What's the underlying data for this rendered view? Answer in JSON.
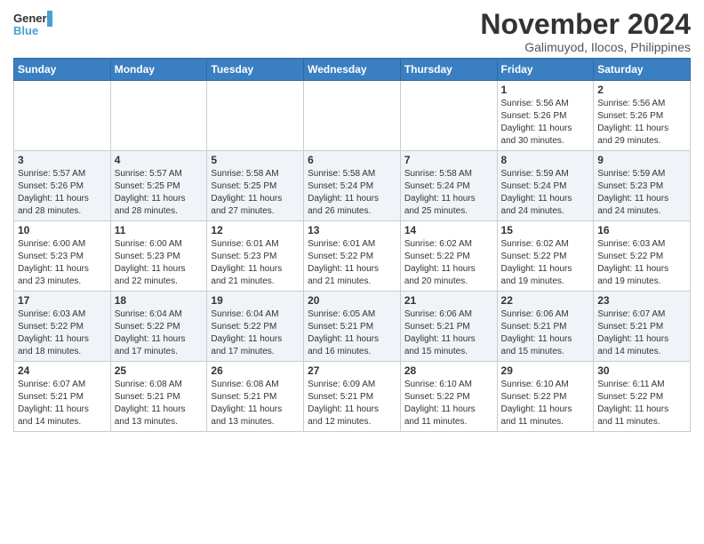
{
  "header": {
    "logo_line1": "General",
    "logo_line2": "Blue",
    "month_title": "November 2024",
    "location": "Galimuyod, Ilocos, Philippines"
  },
  "weekdays": [
    "Sunday",
    "Monday",
    "Tuesday",
    "Wednesday",
    "Thursday",
    "Friday",
    "Saturday"
  ],
  "weeks": [
    [
      {
        "day": "",
        "info": ""
      },
      {
        "day": "",
        "info": ""
      },
      {
        "day": "",
        "info": ""
      },
      {
        "day": "",
        "info": ""
      },
      {
        "day": "",
        "info": ""
      },
      {
        "day": "1",
        "info": "Sunrise: 5:56 AM\nSunset: 5:26 PM\nDaylight: 11 hours\nand 30 minutes."
      },
      {
        "day": "2",
        "info": "Sunrise: 5:56 AM\nSunset: 5:26 PM\nDaylight: 11 hours\nand 29 minutes."
      }
    ],
    [
      {
        "day": "3",
        "info": "Sunrise: 5:57 AM\nSunset: 5:26 PM\nDaylight: 11 hours\nand 28 minutes."
      },
      {
        "day": "4",
        "info": "Sunrise: 5:57 AM\nSunset: 5:25 PM\nDaylight: 11 hours\nand 28 minutes."
      },
      {
        "day": "5",
        "info": "Sunrise: 5:58 AM\nSunset: 5:25 PM\nDaylight: 11 hours\nand 27 minutes."
      },
      {
        "day": "6",
        "info": "Sunrise: 5:58 AM\nSunset: 5:24 PM\nDaylight: 11 hours\nand 26 minutes."
      },
      {
        "day": "7",
        "info": "Sunrise: 5:58 AM\nSunset: 5:24 PM\nDaylight: 11 hours\nand 25 minutes."
      },
      {
        "day": "8",
        "info": "Sunrise: 5:59 AM\nSunset: 5:24 PM\nDaylight: 11 hours\nand 24 minutes."
      },
      {
        "day": "9",
        "info": "Sunrise: 5:59 AM\nSunset: 5:23 PM\nDaylight: 11 hours\nand 24 minutes."
      }
    ],
    [
      {
        "day": "10",
        "info": "Sunrise: 6:00 AM\nSunset: 5:23 PM\nDaylight: 11 hours\nand 23 minutes."
      },
      {
        "day": "11",
        "info": "Sunrise: 6:00 AM\nSunset: 5:23 PM\nDaylight: 11 hours\nand 22 minutes."
      },
      {
        "day": "12",
        "info": "Sunrise: 6:01 AM\nSunset: 5:23 PM\nDaylight: 11 hours\nand 21 minutes."
      },
      {
        "day": "13",
        "info": "Sunrise: 6:01 AM\nSunset: 5:22 PM\nDaylight: 11 hours\nand 21 minutes."
      },
      {
        "day": "14",
        "info": "Sunrise: 6:02 AM\nSunset: 5:22 PM\nDaylight: 11 hours\nand 20 minutes."
      },
      {
        "day": "15",
        "info": "Sunrise: 6:02 AM\nSunset: 5:22 PM\nDaylight: 11 hours\nand 19 minutes."
      },
      {
        "day": "16",
        "info": "Sunrise: 6:03 AM\nSunset: 5:22 PM\nDaylight: 11 hours\nand 19 minutes."
      }
    ],
    [
      {
        "day": "17",
        "info": "Sunrise: 6:03 AM\nSunset: 5:22 PM\nDaylight: 11 hours\nand 18 minutes."
      },
      {
        "day": "18",
        "info": "Sunrise: 6:04 AM\nSunset: 5:22 PM\nDaylight: 11 hours\nand 17 minutes."
      },
      {
        "day": "19",
        "info": "Sunrise: 6:04 AM\nSunset: 5:22 PM\nDaylight: 11 hours\nand 17 minutes."
      },
      {
        "day": "20",
        "info": "Sunrise: 6:05 AM\nSunset: 5:21 PM\nDaylight: 11 hours\nand 16 minutes."
      },
      {
        "day": "21",
        "info": "Sunrise: 6:06 AM\nSunset: 5:21 PM\nDaylight: 11 hours\nand 15 minutes."
      },
      {
        "day": "22",
        "info": "Sunrise: 6:06 AM\nSunset: 5:21 PM\nDaylight: 11 hours\nand 15 minutes."
      },
      {
        "day": "23",
        "info": "Sunrise: 6:07 AM\nSunset: 5:21 PM\nDaylight: 11 hours\nand 14 minutes."
      }
    ],
    [
      {
        "day": "24",
        "info": "Sunrise: 6:07 AM\nSunset: 5:21 PM\nDaylight: 11 hours\nand 14 minutes."
      },
      {
        "day": "25",
        "info": "Sunrise: 6:08 AM\nSunset: 5:21 PM\nDaylight: 11 hours\nand 13 minutes."
      },
      {
        "day": "26",
        "info": "Sunrise: 6:08 AM\nSunset: 5:21 PM\nDaylight: 11 hours\nand 13 minutes."
      },
      {
        "day": "27",
        "info": "Sunrise: 6:09 AM\nSunset: 5:21 PM\nDaylight: 11 hours\nand 12 minutes."
      },
      {
        "day": "28",
        "info": "Sunrise: 6:10 AM\nSunset: 5:22 PM\nDaylight: 11 hours\nand 11 minutes."
      },
      {
        "day": "29",
        "info": "Sunrise: 6:10 AM\nSunset: 5:22 PM\nDaylight: 11 hours\nand 11 minutes."
      },
      {
        "day": "30",
        "info": "Sunrise: 6:11 AM\nSunset: 5:22 PM\nDaylight: 11 hours\nand 11 minutes."
      }
    ]
  ]
}
